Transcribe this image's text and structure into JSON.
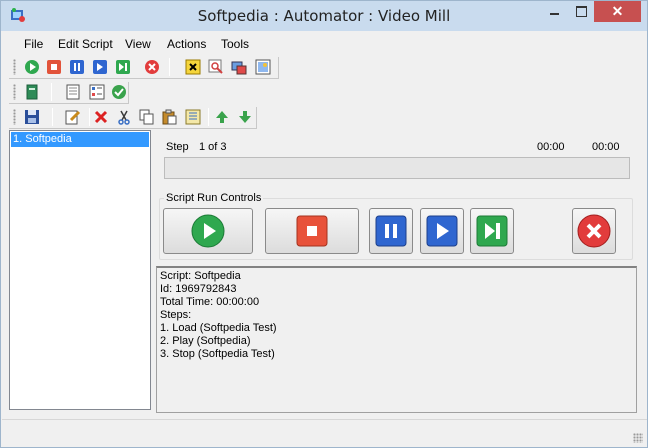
{
  "window": {
    "title": "Softpedia : Automator : Video Mill"
  },
  "menu": [
    "File",
    "Edit Script",
    "View",
    "Actions",
    "Tools"
  ],
  "toolbar1": {
    "icons": [
      "play-icon",
      "stop-icon",
      "pause-icon",
      "step-icon",
      "next-icon",
      "close-circle-icon",
      "x-box-icon",
      "zoom-icon",
      "capture-icon",
      "image-icon"
    ]
  },
  "toolbar2": {
    "icons": [
      "book-icon",
      "notebook-icon",
      "list-icon",
      "check-circle-icon"
    ]
  },
  "toolbar3": {
    "icons": [
      "save-icon",
      "edit-icon",
      "delete-icon",
      "cut-icon",
      "copy-icon",
      "paste-icon",
      "properties-icon",
      "up-arrow-icon",
      "down-arrow-icon"
    ]
  },
  "tree": {
    "items": [
      "1. Softpedia"
    ]
  },
  "step": {
    "label": "Step",
    "value": "1 of 3",
    "time_elapsed": "00:00",
    "time_total": "00:00",
    "progress": 0
  },
  "controls": {
    "title": "Script Run Controls"
  },
  "output": {
    "lines": [
      "Script: Softpedia",
      "Id: 1969792843",
      "Total Time: 00:00:00",
      "Steps:",
      "1. Load (Softpedia Test)",
      "2. Play (Softpedia)",
      "3. Stop (Softpedia Test)"
    ]
  },
  "colors": {
    "selection": "#3399ff",
    "titlebar": "#c9dbee",
    "close": "#c75050"
  }
}
